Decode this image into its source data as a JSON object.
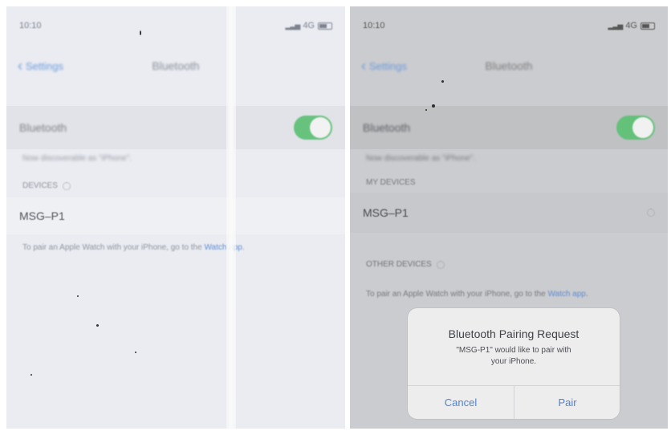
{
  "left_phone": {
    "status_time": "10:10",
    "status_network": "4G",
    "back_label": "Settings",
    "title": "Bluetooth",
    "bluetooth_label": "Bluetooth",
    "discover_note": "Now discoverable as \"iPhone\".",
    "section_my_devices": "DEVICES",
    "device_name": "MSG–P1",
    "watch_note_prefix": "To pair an Apple Watch with your iPhone, go to the ",
    "watch_link": "Watch app",
    "watch_note_suffix": "."
  },
  "right_phone": {
    "status_time": "10:10",
    "status_network": "4G",
    "back_label": "Settings",
    "title": "Bluetooth",
    "bluetooth_label": "Bluetooth",
    "discover_note": "Now discoverable as \"iPhone\".",
    "section_my_devices": "MY DEVICES",
    "device_name": "MSG–P1",
    "section_other_devices": "OTHER DEVICES",
    "watch_note_prefix": "To pair an Apple Watch with your iPhone, go to the ",
    "watch_link": "Watch app",
    "watch_note_suffix": "."
  },
  "dialog": {
    "title": "Bluetooth Pairing Request",
    "message_line1": "\"MSG-P1\" would like to pair with",
    "message_line2": "your iPhone.",
    "cancel_label": "Cancel",
    "pair_label": "Pair"
  },
  "colors": {
    "toggle_on": "#62c47a",
    "link_blue": "#4f82cf"
  },
  "icons": [
    "chevron-left-icon",
    "signal-icon",
    "battery-icon",
    "spinner-icon",
    "bluetooth-toggle"
  ]
}
